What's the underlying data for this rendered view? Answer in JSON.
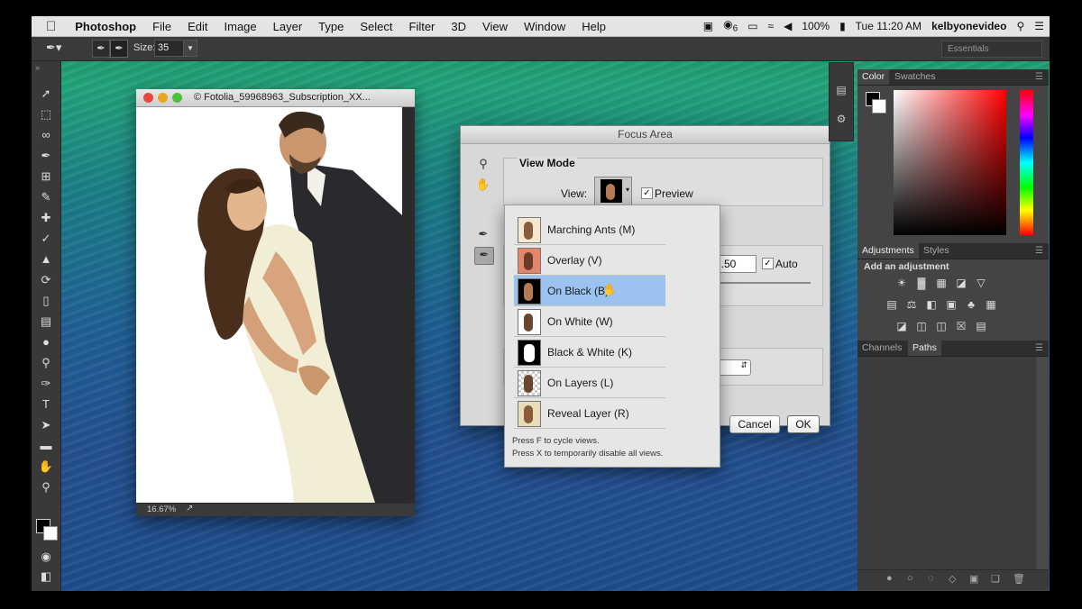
{
  "menubar": {
    "apple": "",
    "app": "Photoshop",
    "items": [
      "File",
      "Edit",
      "Image",
      "Layer",
      "Type",
      "Select",
      "Filter",
      "3D",
      "View",
      "Window",
      "Help"
    ],
    "status": {
      "notif_count": "6",
      "battery": "100%",
      "datetime": "Tue 11:20 AM",
      "user": "kelbyonevideo"
    }
  },
  "options_bar": {
    "size_label": "Size:",
    "size_value": "35",
    "workspace": "Essentials"
  },
  "document": {
    "title": "© Fotolia_59968963_Subscription_XX...",
    "zoom": "16.67%"
  },
  "dialog": {
    "title": "Focus Area",
    "view_mode_heading": "View Mode",
    "view_label": "View:",
    "preview_label": "Preview",
    "preview_checked": true,
    "param_value": "3.50",
    "auto_label": "Auto",
    "auto_checked": true,
    "cancel": "Cancel",
    "ok": "OK"
  },
  "view_dropdown": {
    "options": [
      {
        "label": "Marching Ants (M)",
        "selected": false
      },
      {
        "label": "Overlay (V)",
        "selected": false
      },
      {
        "label": "On Black (B)",
        "selected": true
      },
      {
        "label": "On White (W)",
        "selected": false
      },
      {
        "label": "Black & White (K)",
        "selected": false
      },
      {
        "label": "On Layers (L)",
        "selected": false
      },
      {
        "label": "Reveal Layer (R)",
        "selected": false
      }
    ],
    "hint1": "Press F to cycle views.",
    "hint2": "Press X to temporarily disable all views."
  },
  "panels": {
    "color_tab": "Color",
    "swatches_tab": "Swatches",
    "adjustments_tab": "Adjustments",
    "styles_tab": "Styles",
    "add_adjustment": "Add an adjustment",
    "channels_tab": "Channels",
    "paths_tab": "Paths"
  },
  "colors": {
    "menu_bg": "#e4e4e4",
    "panel_bg": "#444444",
    "selected_option": "#9cc3ef"
  }
}
